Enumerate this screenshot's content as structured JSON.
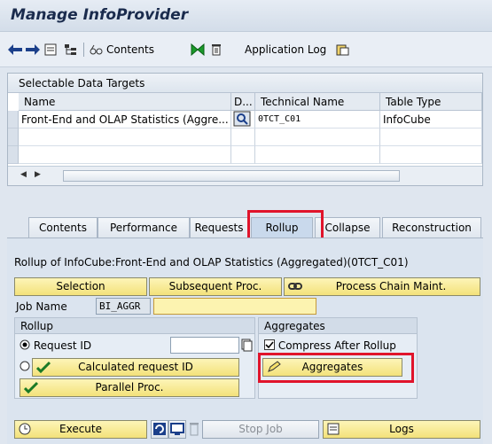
{
  "window": {
    "title": "Manage InfoProvider"
  },
  "toolbar": {
    "contents_label": "Contents",
    "app_log_label": "Application Log"
  },
  "data_targets": {
    "title": "Selectable Data Targets",
    "columns": [
      "Name",
      "D...",
      "Technical Name",
      "Table Type"
    ],
    "rows": [
      {
        "name": "Front-End and OLAP Statistics (Aggre...",
        "technical_name": "0TCT_C01",
        "table_type": "InfoCube"
      }
    ]
  },
  "tabs": [
    "Contents",
    "Performance",
    "Requests",
    "Rollup",
    "Collapse",
    "Reconstruction"
  ],
  "rollup_tab": {
    "info_text": "Rollup of InfoCube:Front-End and OLAP Statistics (Aggregated)(0TCT_C01)",
    "selection_label": "Selection",
    "subsequent_label": "Subsequent Proc.",
    "process_chain_label": "Process Chain Maint.",
    "job_name_label": "Job Name",
    "job_name_value": "BI_AGGR",
    "rollup_group_title": "Rollup",
    "request_id_label": "Request ID",
    "calculated_request_label": "Calculated request ID",
    "parallel_label": "Parallel Proc.",
    "aggregates_group_title": "Aggregates",
    "compress_label": "Compress After Rollup",
    "aggregates_button_label": "Aggregates",
    "execute_label": "Execute",
    "stop_job_label": "Stop Job",
    "logs_label": "Logs"
  },
  "colors": {
    "highlight": "#e0142b",
    "button_yellow": "#f3e27a"
  }
}
